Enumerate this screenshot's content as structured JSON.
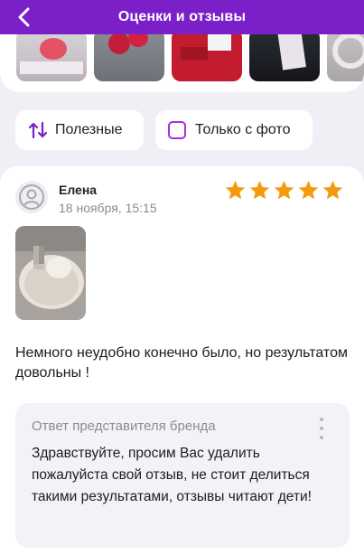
{
  "header": {
    "title": "Оценки и отзывы",
    "back_icon": "chevron-left-icon"
  },
  "colors": {
    "brand": "#7b1fc9",
    "star": "#f59a0f",
    "checkbox": "#a62de0",
    "sort_icon": "#7b1fc9"
  },
  "filters": {
    "useful_label": "Полезные",
    "useful_icon": "sort-arrows-icon",
    "photo_label": "Только с фото",
    "photo_icon": "checkbox-icon"
  },
  "review": {
    "author": "Елена",
    "date": "18 ноября, 15:15",
    "rating": 5,
    "rating_max": 5,
    "text": "Немного неудобно конечно было, но результатом довольны !",
    "reply": {
      "title": "Ответ представителя бренда",
      "text": "Здравствуйте, просим Вас удалить пожалуйста свой отзыв, не стоит делиться такими результатами, отзывы читают дети!"
    }
  }
}
